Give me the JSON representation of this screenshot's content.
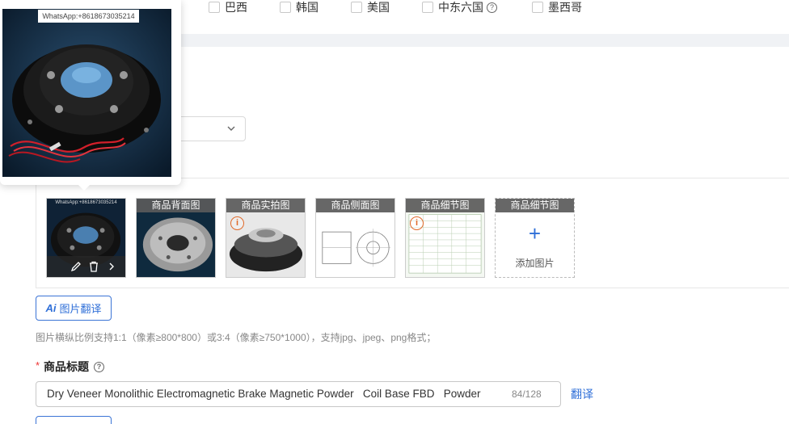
{
  "countries": [
    {
      "label": "巴西"
    },
    {
      "label": "韩国"
    },
    {
      "label": "美国"
    },
    {
      "label": "中东六国",
      "help": "?"
    },
    {
      "label": "墨西哥"
    }
  ],
  "preview": {
    "watermark": "WhatsApp:+8618673035214"
  },
  "images": [
    {
      "caption": "",
      "watermark": "WhatsApp:+8618673035214",
      "has_tools": true,
      "warning": false
    },
    {
      "caption": "商品背面图",
      "warning": false
    },
    {
      "caption": "商品实拍图",
      "warning": true
    },
    {
      "caption": "商品侧面图",
      "warning": false
    },
    {
      "caption": "商品细节图",
      "warning": true
    }
  ],
  "add_slot": {
    "caption": "商品细节图",
    "plus": "+",
    "label": "添加图片"
  },
  "warning_glyph": "i",
  "translate_button": {
    "ai": "Ai",
    "label": "图片翻译"
  },
  "hint": "图片横纵比例支持1:1（像素≥800*800）或3:4（像素≥750*1000），支持jpg、jpeg、png格式；",
  "title_field": {
    "required_mark": "*",
    "label": "商品标题",
    "help": "?",
    "value": "Dry Veneer Monolithic Electromagnetic Brake Magnetic Powder   Coil Base FBD   Powder",
    "counter": "84/128",
    "translate_link": "翻译"
  },
  "icons": {
    "edit": "pencil-icon",
    "delete": "trash-icon",
    "next": "chevron-right-icon",
    "dropdown": "chevron-down-icon"
  },
  "colors": {
    "accent": "#2f6fd8",
    "warning": "#e06a2a",
    "required": "#e33333"
  }
}
